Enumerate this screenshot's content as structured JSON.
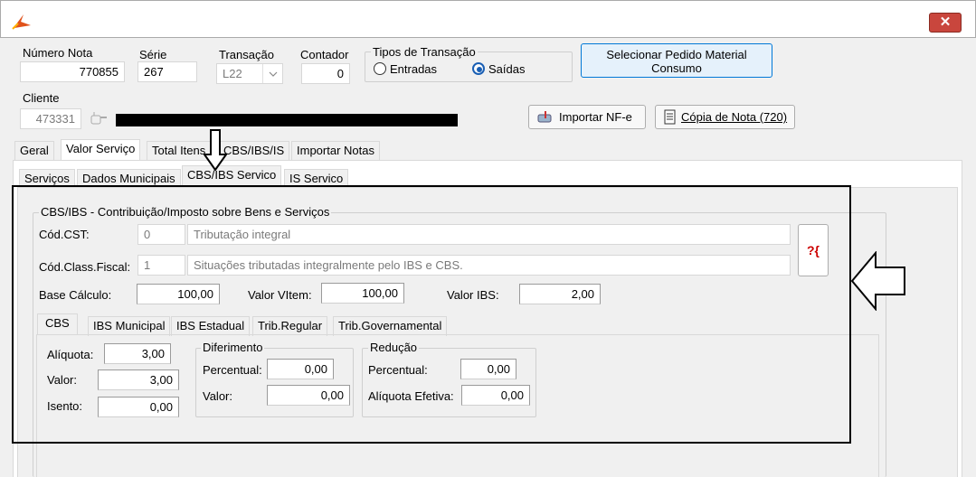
{
  "window": {
    "close_glyph": "✕"
  },
  "header": {
    "numero_nota_label": "Número Nota",
    "numero_nota_value": "770855",
    "serie_label": "Série",
    "serie_value": "267",
    "transacao_label": "Transação",
    "transacao_value": "L22",
    "contador_label": "Contador",
    "contador_value": "0",
    "tipos_label": "Tipos de Transação",
    "entradas_label": "Entradas",
    "saidas_label": "Saídas",
    "selected_tipo": "Saídas",
    "select_pedido_button": "Selecionar Pedido Material Consumo",
    "cliente_label": "Cliente",
    "cliente_value": "473331",
    "importar_button": "Importar NF-e",
    "copia_button": "Cópia de Nota (720)"
  },
  "main_tabs": [
    {
      "label": "Geral",
      "active": false
    },
    {
      "label": "Valor Serviço",
      "active": true
    },
    {
      "label": "Total Itens",
      "active": false
    },
    {
      "label": "CBS/IBS/IS",
      "active": false
    },
    {
      "label": "Importar Notas",
      "active": false
    }
  ],
  "sub_tabs": [
    {
      "label": "Serviços",
      "active": false
    },
    {
      "label": "Dados Municipais",
      "active": false
    },
    {
      "label": "CBS/IBS Servico",
      "active": true
    },
    {
      "label": "IS Servico",
      "active": false
    }
  ],
  "cbs_ibs": {
    "group_title": "CBS/IBS -  Contribuição/Imposto sobre Bens e Serviços",
    "cst_label": "Cód.CST:",
    "cst_code": "0",
    "cst_desc": "Tributação integral",
    "class_label": "Cód.Class.Fiscal:",
    "class_code": "1",
    "class_desc": "Situações tributadas integralmente pelo IBS e CBS.",
    "help_glyph": "?{",
    "base_label": "Base Cálculo:",
    "base_value": "100,00",
    "vitem_label": "Valor VItem:",
    "vitem_value": "100,00",
    "vibs_label": "Valor IBS:",
    "vibs_value": "2,00"
  },
  "inner_tabs": [
    {
      "label": "CBS",
      "active": true
    },
    {
      "label": "IBS Municipal",
      "active": false
    },
    {
      "label": "IBS Estadual",
      "active": false
    },
    {
      "label": "Trib.Regular",
      "active": false
    },
    {
      "label": "Trib.Governamental",
      "active": false
    }
  ],
  "cbs_tab": {
    "aliquota_label": "Alíquota:",
    "aliquota_value": "3,00",
    "valor_label": "Valor:",
    "valor_value": "3,00",
    "isento_label": "Isento:",
    "isento_value": "0,00",
    "diferimento_title": "Diferimento",
    "dif_percentual_label": "Percentual:",
    "dif_percentual_value": "0,00",
    "dif_valor_label": "Valor:",
    "dif_valor_value": "0,00",
    "reducao_title": "Redução",
    "red_percentual_label": "Percentual:",
    "red_percentual_value": "0,00",
    "red_aliquota_label": "Alíquota Efetiva:",
    "red_aliquota_value": "0,00"
  },
  "colors": {
    "accent": "#0078d7",
    "close": "#c9463d",
    "logo": "#e0521b"
  }
}
